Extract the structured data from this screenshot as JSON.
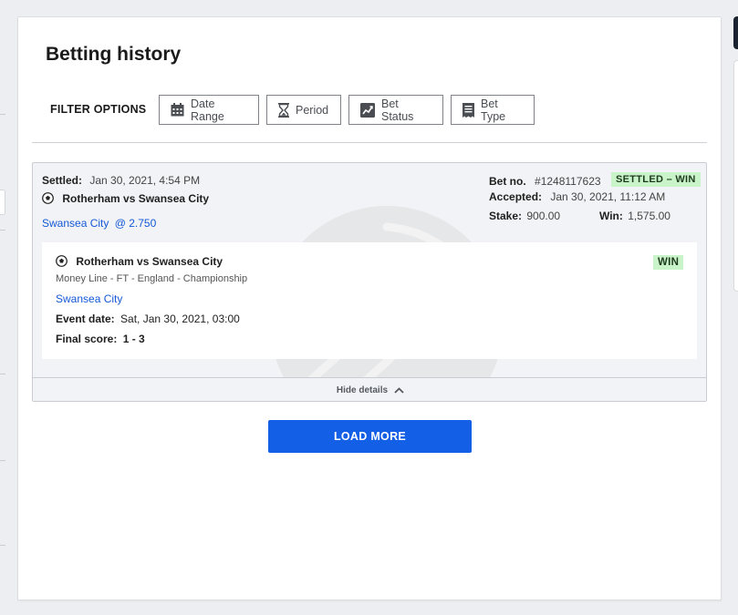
{
  "page": {
    "title": "Betting history"
  },
  "filters": {
    "label": "FILTER OPTIONS",
    "buttons": [
      {
        "label": "Date Range",
        "icon": "calendar-icon"
      },
      {
        "label": "Period",
        "icon": "hourglass-icon"
      },
      {
        "label": "Bet Status",
        "icon": "trend-chart-icon"
      },
      {
        "label": "Bet Type",
        "icon": "receipt-icon"
      }
    ]
  },
  "bet": {
    "settled_label": "Settled:",
    "settled_value": "Jan 30, 2021, 4:54 PM",
    "match": "Rotherham vs Swansea City",
    "selection": "Swansea City",
    "odds": "@ 2.750",
    "betno_label": "Bet no.",
    "betno_value": "#1248117623",
    "status_badge": "SETTLED – WIN",
    "accepted_label": "Accepted:",
    "accepted_value": "Jan 30, 2021, 11:12 AM",
    "stake_label": "Stake:",
    "stake_value": "900.00",
    "win_label": "Win:",
    "win_value": "1,575.00",
    "detail": {
      "match": "Rotherham vs Swansea City",
      "market": "Money Line - FT - England - Championship",
      "selection": "Swansea City",
      "event_label": "Event date:",
      "event_value": "Sat, Jan 30, 2021, 03:00",
      "score_label": "Final score:",
      "score_value": "1 - 3",
      "result_badge": "WIN"
    },
    "hide_details": "Hide details"
  },
  "load_more": "LOAD MORE",
  "colors": {
    "accent": "#135fe6",
    "link": "#1558d6",
    "win_badge": "#c9f3c9"
  }
}
